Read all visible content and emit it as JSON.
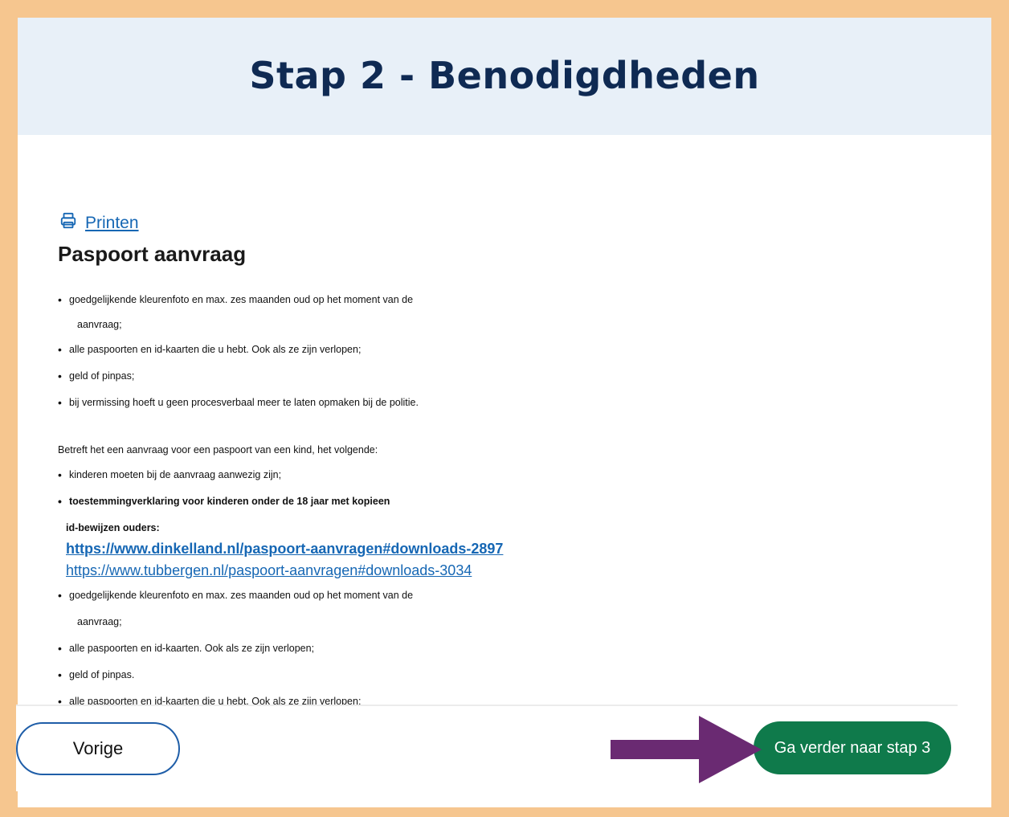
{
  "header": {
    "title": "Stap 2 - Benodigdheden"
  },
  "print": {
    "label": "Printen",
    "icon": "printer-icon"
  },
  "section": {
    "title": "Paspoort aanvraag"
  },
  "list1": [
    "goedgelijkende kleurenfoto en max. zes maanden oud op het moment van de",
    "aanvraag;",
    "alle paspoorten en id-kaarten die u hebt. Ook als ze zijn verlopen;",
    "geld of pinpas;",
    "bij vermissing hoeft u geen procesverbaal meer te laten opmaken bij de politie."
  ],
  "child_intro": "Betreft het een aanvraag voor een paspoort van een kind, het volgende:",
  "list2": [
    "kinderen moeten bij de aanvraag aanwezig zijn;",
    "toestemmingverklaring voor kinderen onder de 18 jaar met kopieen",
    "id-bewijzen ouders:"
  ],
  "links": [
    "https://www.dinkelland.nl/paspoort-aanvragen#downloads-2897",
    "https://www.tubbergen.nl/paspoort-aanvragen#downloads-3034"
  ],
  "list3": [
    "goedgelijkende kleurenfoto en max. zes maanden oud op het moment van de",
    "aanvraag;",
    "alle paspoorten en id-kaarten. Ook als ze zijn verlopen;",
    "geld of pinpas.",
    "alle paspoorten en id-kaarten die u hebt. Ook als ze zijn verlopen;"
  ],
  "footer": {
    "prev_label": "Vorige",
    "next_label": "Ga verder naar stap 3"
  },
  "colors": {
    "frame": "#f6c68f",
    "header_bg": "#e8f0f8",
    "title": "#0f2a53",
    "link": "#1667b4",
    "next_button": "#0f7a4b",
    "arrow": "#6a2a72"
  }
}
